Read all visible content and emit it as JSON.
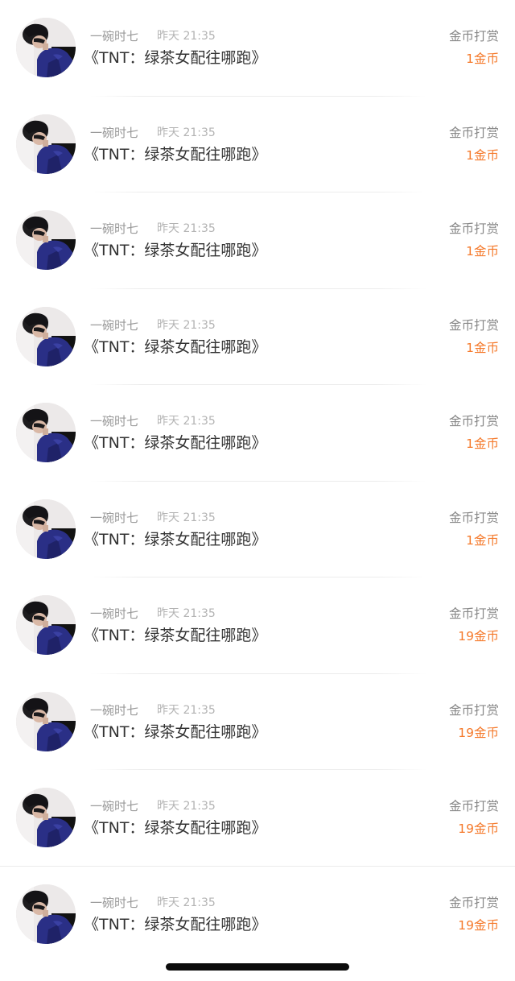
{
  "header_icon": "avatar-photo",
  "colors": {
    "username": "#9a9a9a",
    "time": "#b3b3b3",
    "title": "#333333",
    "type": "#888888",
    "amount": "#f57a2c",
    "divider": "#ececec"
  },
  "records": [
    {
      "user": "一碗时七",
      "time": "昨天 21:35",
      "title": "《TNT：绿茶女配往哪跑》",
      "type": "金币打赏",
      "amount": "1金币"
    },
    {
      "user": "一碗时七",
      "time": "昨天 21:35",
      "title": "《TNT：绿茶女配往哪跑》",
      "type": "金币打赏",
      "amount": "1金币"
    },
    {
      "user": "一碗时七",
      "time": "昨天 21:35",
      "title": "《TNT：绿茶女配往哪跑》",
      "type": "金币打赏",
      "amount": "1金币"
    },
    {
      "user": "一碗时七",
      "time": "昨天 21:35",
      "title": "《TNT：绿茶女配往哪跑》",
      "type": "金币打赏",
      "amount": "1金币"
    },
    {
      "user": "一碗时七",
      "time": "昨天 21:35",
      "title": "《TNT：绿茶女配往哪跑》",
      "type": "金币打赏",
      "amount": "1金币"
    },
    {
      "user": "一碗时七",
      "time": "昨天 21:35",
      "title": "《TNT：绿茶女配往哪跑》",
      "type": "金币打赏",
      "amount": "1金币"
    },
    {
      "user": "一碗时七",
      "time": "昨天 21:35",
      "title": "《TNT：绿茶女配往哪跑》",
      "type": "金币打赏",
      "amount": "19金币"
    },
    {
      "user": "一碗时七",
      "time": "昨天 21:35",
      "title": "《TNT：绿茶女配往哪跑》",
      "type": "金币打赏",
      "amount": "19金币"
    },
    {
      "user": "一碗时七",
      "time": "昨天 21:35",
      "title": "《TNT：绿茶女配往哪跑》",
      "type": "金币打赏",
      "amount": "19金币"
    },
    {
      "user": "一碗时七",
      "time": "昨天 21:35",
      "title": "《TNT：绿茶女配往哪跑》",
      "type": "金币打赏",
      "amount": "19金币"
    }
  ]
}
